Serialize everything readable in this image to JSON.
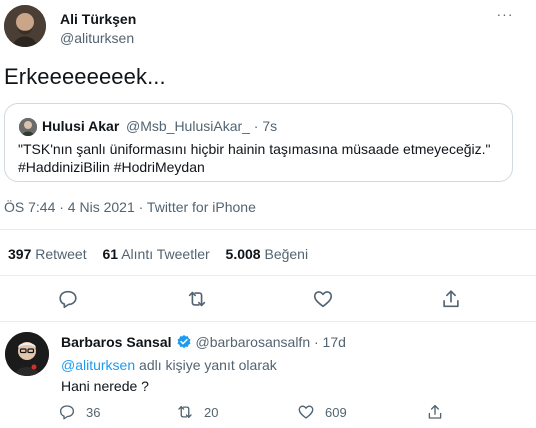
{
  "main_tweet": {
    "author_name": "Ali Türkşen",
    "author_handle": "@aliturksen",
    "more_label": "···",
    "text": "Erkeeeeeeeek...",
    "quote": {
      "author_name": "Hulusi Akar",
      "author_handle": "@Msb_HulusiAkar_ · 7s",
      "text_line1": "\"TSK'nın şanlı üniformasını hiçbir hainin taşımasına müsaade etmeyeceğiz.\"",
      "text_line2": "#HaddiniziBilin #HodriMeydan"
    },
    "meta": "ÖS 7:44 · 4 Nis 2021 · Twitter for iPhone",
    "stats": {
      "retweets_count": "397",
      "retweets_label": "Retweet",
      "quotes_count": "61",
      "quotes_label": "Alıntı Tweetler",
      "likes_count": "5.008",
      "likes_label": "Beğeni"
    },
    "actions": [
      "reply-icon",
      "retweet-icon",
      "like-icon",
      "share-icon"
    ]
  },
  "reply": {
    "author_name": "Barbaros Sansal",
    "author_handle": "@barbarosansalfn · 17d",
    "reply_to_handle": "@aliturksen",
    "reply_to_suffix": " adlı kişiye yanıt olarak",
    "text": "Hani nerede ?",
    "counts": {
      "replies": "36",
      "retweets": "20",
      "likes": "609"
    }
  },
  "colors": {
    "accent": "#1d9bf0",
    "text": "#0f1419",
    "muted": "#536471",
    "border": "#cfd9de"
  }
}
